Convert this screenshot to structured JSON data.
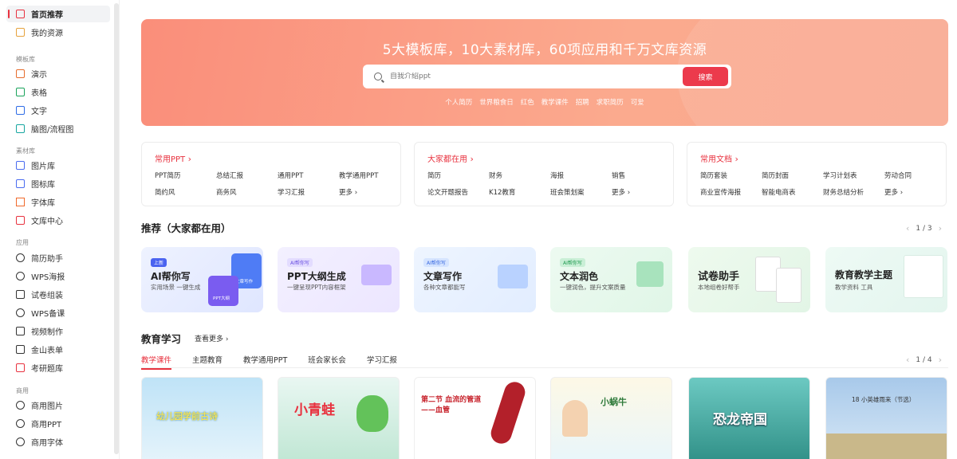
{
  "sidebar": {
    "top_items": [
      {
        "label": "首页推荐",
        "icon": "home-icon",
        "active": true
      },
      {
        "label": "我的资源",
        "icon": "folder-icon",
        "active": false
      }
    ],
    "sections": [
      {
        "title": "模板库",
        "items": [
          {
            "label": "演示",
            "icon": "presentation-icon"
          },
          {
            "label": "表格",
            "icon": "spreadsheet-icon"
          },
          {
            "label": "文字",
            "icon": "document-icon"
          },
          {
            "label": "脑图/流程图",
            "icon": "mindmap-icon"
          }
        ]
      },
      {
        "title": "素材库",
        "items": [
          {
            "label": "图片库",
            "icon": "image-icon"
          },
          {
            "label": "图标库",
            "icon": "icon-library-icon"
          },
          {
            "label": "字体库",
            "icon": "font-icon"
          },
          {
            "label": "文库中心",
            "icon": "library-icon"
          }
        ]
      },
      {
        "title": "应用",
        "items": [
          {
            "label": "简历助手",
            "icon": "resume-icon"
          },
          {
            "label": "WPS海报",
            "icon": "poster-icon"
          },
          {
            "label": "试卷组装",
            "icon": "exam-icon"
          },
          {
            "label": "WPS备课",
            "icon": "lesson-icon"
          },
          {
            "label": "视频制作",
            "icon": "video-icon"
          },
          {
            "label": "金山表单",
            "icon": "form-icon"
          },
          {
            "label": "考研题库",
            "icon": "question-bank-icon"
          }
        ]
      },
      {
        "title": "商用",
        "items": [
          {
            "label": "商用图片",
            "icon": "commercial-image-icon"
          },
          {
            "label": "商用PPT",
            "icon": "commercial-ppt-icon"
          },
          {
            "label": "商用字体",
            "icon": "commercial-font-icon"
          }
        ]
      }
    ]
  },
  "hero": {
    "title": "5大模板库，10大素材库，60项应用和千万文库资源",
    "search_placeholder": "自我介绍ppt",
    "search_button": "搜索",
    "hot_keywords": [
      "个人简历",
      "世界粮食日",
      "红色",
      "教学课件",
      "招聘",
      "求职简历",
      "可爱"
    ]
  },
  "categories": [
    {
      "title": "常用PPT",
      "items": [
        "PPT简历",
        "总结汇报",
        "通用PPT",
        "教学通用PPT",
        "简约风",
        "商务风",
        "学习汇报",
        "更多 ›"
      ]
    },
    {
      "title": "大家都在用",
      "items": [
        "简历",
        "财务",
        "海报",
        "销售",
        "论文开题报告",
        "K12教育",
        "班会策划案",
        "更多 ›"
      ]
    },
    {
      "title": "常用文档",
      "items": [
        "简历套装",
        "简历封面",
        "学习计划表",
        "劳动合同",
        "商业宣传海报",
        "智能电商表",
        "财务总结分析",
        "更多 ›"
      ]
    }
  ],
  "recommend": {
    "title": "推荐（大家都在用）",
    "pager": "1 / 3",
    "cards": [
      {
        "badge": "上新",
        "title": "AI帮你写",
        "sub": "实用场景  一键生成",
        "deco1": "文章写作",
        "deco2": "PPT大纲"
      },
      {
        "badge": "AI帮你写",
        "title": "PPT大纲生成",
        "sub": "一键呈现PPT内容框架"
      },
      {
        "badge": "AI帮你写",
        "title": "文章写作",
        "sub": "各种文章都能写"
      },
      {
        "badge": "AI帮你写",
        "title": "文本润色",
        "sub": "一键润色，提升文案质量"
      },
      {
        "title": "试卷助手",
        "sub": "本地组卷好帮手"
      },
      {
        "title": "教育教学主题",
        "sub": "教学资料  工具"
      }
    ]
  },
  "education": {
    "title": "教育学习",
    "more": "查看更多 ›",
    "pager": "1 / 4",
    "tabs": [
      "教学课件",
      "主题教育",
      "教学通用PPT",
      "班会家长会",
      "学习汇报"
    ],
    "thumbs": [
      {
        "text": "幼儿园学前古诗"
      },
      {
        "text": "小青蛙"
      },
      {
        "text": "第二节 血流的管道——血管"
      },
      {
        "text": "小蜗牛"
      },
      {
        "text": "恐龙帝国"
      },
      {
        "text": "18 小英雄雨来（节选）"
      }
    ]
  },
  "colors": {
    "accent": "#e8323f",
    "hero_start": "#fa8e7a",
    "hero_end": "#f9a78f"
  }
}
